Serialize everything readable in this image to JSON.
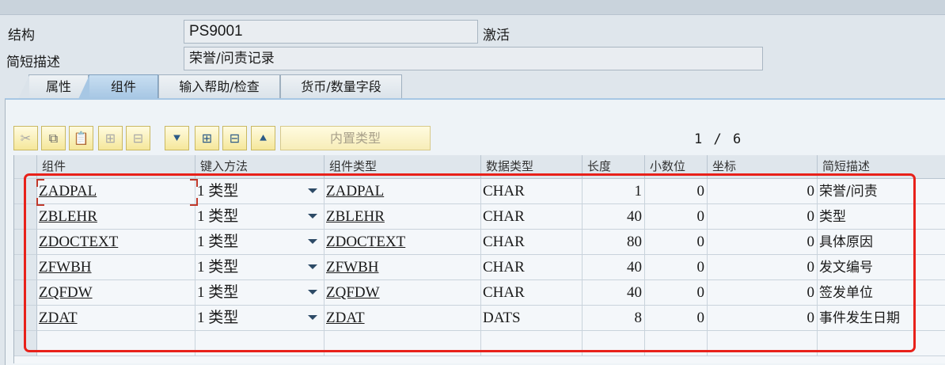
{
  "header": {
    "structure_label": "结构",
    "structure_value": "PS9001",
    "status": "激活",
    "short_desc_label": "简短描述",
    "short_desc_value": "荣誉/问责记录"
  },
  "tabs": [
    {
      "label": "属性",
      "active": false
    },
    {
      "label": "组件",
      "active": true
    },
    {
      "label": "输入帮助/检查",
      "active": false
    },
    {
      "label": "货币/数量字段",
      "active": false
    }
  ],
  "toolbar": {
    "buttons": [
      {
        "name": "cut-icon",
        "glyph": "✂"
      },
      {
        "name": "copy-icon",
        "glyph": "⧉"
      },
      {
        "name": "paste-icon",
        "glyph": "📋"
      },
      {
        "name": "insert-row-icon",
        "glyph": "⊞"
      },
      {
        "name": "delete-row-icon",
        "glyph": "⊟"
      },
      {
        "name": "move-down-icon",
        "glyph": "⯆"
      },
      {
        "name": "expand-icon",
        "glyph": "⊞"
      },
      {
        "name": "collapse-icon",
        "glyph": "⊟"
      },
      {
        "name": "move-up-icon",
        "glyph": "⯅"
      }
    ],
    "builtin_type_label": "内置类型",
    "page_current": "1",
    "page_total": "6"
  },
  "table": {
    "columns": [
      "组件",
      "键入方法",
      "组件类型",
      "数据类型",
      "长度",
      "小数位",
      "坐标",
      "简短描述"
    ],
    "rows": [
      {
        "component": "ZADPAL",
        "method": "1 类型",
        "type": "ZADPAL",
        "datatype": "CHAR",
        "length": "1",
        "decimals": "0",
        "coord": "0",
        "desc": "荣誉/问责"
      },
      {
        "component": "ZBLEHR",
        "method": "1 类型",
        "type": "ZBLEHR",
        "datatype": "CHAR",
        "length": "40",
        "decimals": "0",
        "coord": "0",
        "desc": "类型"
      },
      {
        "component": "ZDOCTEXT",
        "method": "1 类型",
        "type": "ZDOCTEXT",
        "datatype": "CHAR",
        "length": "80",
        "decimals": "0",
        "coord": "0",
        "desc": "具体原因"
      },
      {
        "component": "ZFWBH",
        "method": "1 类型",
        "type": "ZFWBH",
        "datatype": "CHAR",
        "length": "40",
        "decimals": "0",
        "coord": "0",
        "desc": "发文编号"
      },
      {
        "component": "ZQFDW",
        "method": "1 类型",
        "type": "ZQFDW",
        "datatype": "CHAR",
        "length": "40",
        "decimals": "0",
        "coord": "0",
        "desc": "签发单位"
      },
      {
        "component": "ZDAT",
        "method": "1 类型",
        "type": "ZDAT",
        "datatype": "DATS",
        "length": "8",
        "decimals": "0",
        "coord": "0",
        "desc": "事件发生日期"
      }
    ]
  },
  "colors": {
    "highlight": "#e8211a",
    "tab_active": "#a7c7e4",
    "toolbar_button": "#f5e79a"
  }
}
